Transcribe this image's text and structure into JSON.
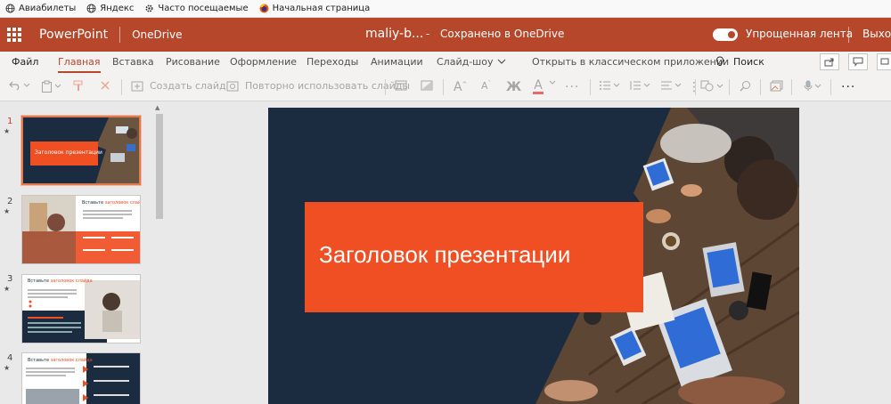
{
  "bookmarks": [
    {
      "label": "Авиабилеты",
      "icon": "globe-icon"
    },
    {
      "label": "Яндекс",
      "icon": "globe-icon"
    },
    {
      "label": "Часто посещаемые",
      "icon": "gear-icon"
    },
    {
      "label": "Начальная страница",
      "icon": "firefox-icon"
    }
  ],
  "titlebar": {
    "app_name": "PowerPoint",
    "service": "OneDrive",
    "doc_name": "maliy-b...",
    "dash": "-",
    "save_status": "Сохранено в OneDrive",
    "simplified_ribbon": "Упрощенная лента",
    "exit": "Выход"
  },
  "tabs": {
    "file": "Файл",
    "home": "Главная",
    "insert": "Вставка",
    "draw": "Рисование",
    "design": "Оформление",
    "transitions": "Переходы",
    "animations": "Анимации",
    "slideshow": "Слайд-шоу",
    "open_desktop": "Открыть в классическом приложении",
    "search": "Поиск"
  },
  "ribbon": {
    "new_slide": "Создать слайд",
    "reuse_slides": "Повторно использовать слайды",
    "font_grow": "A",
    "font_shrink": "A",
    "bold": "Ж",
    "font_color": "A",
    "more": "···",
    "overflow": "···"
  },
  "slides": [
    {
      "number": "1",
      "marker": "★"
    },
    {
      "number": "2",
      "marker": "★"
    },
    {
      "number": "3",
      "marker": "★"
    },
    {
      "number": "4",
      "marker": "★"
    }
  ],
  "thumb_text": {
    "slide1_title": "Заголовок презентации",
    "insert_word": "Вставьте",
    "highlight_word": "заголовок слайда"
  },
  "slide": {
    "title": "Заголовок презентации"
  },
  "colors": {
    "brand": "#b7472a",
    "slide_bg": "#1b2c40",
    "accent": "#f04e23"
  }
}
